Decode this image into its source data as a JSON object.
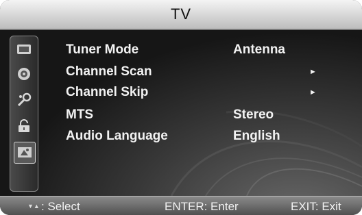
{
  "window": {
    "title": "TV"
  },
  "sidebar": {
    "items": [
      {
        "icon": "picture-icon"
      },
      {
        "icon": "sound-icon"
      },
      {
        "icon": "setup-icon"
      },
      {
        "icon": "lock-icon"
      },
      {
        "icon": "channel-icon",
        "selected": true
      }
    ]
  },
  "menu": {
    "items": [
      {
        "label": "Tuner Mode",
        "value": "Antenna"
      },
      {
        "label": "Channel Scan",
        "value": "►"
      },
      {
        "label": "Channel Skip",
        "value": "►"
      },
      {
        "label": "MTS",
        "value": "Stereo"
      },
      {
        "label": "Audio Language",
        "value": "English"
      }
    ]
  },
  "helpbar": {
    "select_arrows": "▼▲",
    "select": ": Select",
    "enter": "ENTER: Enter",
    "exit": "EXIT: Exit"
  }
}
